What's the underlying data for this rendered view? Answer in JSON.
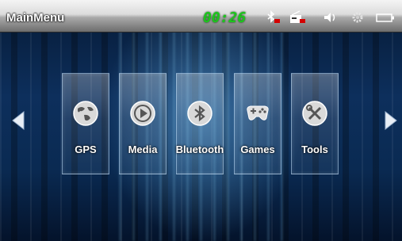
{
  "header": {
    "title": "MainMenu",
    "clock": "00:26",
    "status_icons": [
      "bluetooth-disabled-icon",
      "radio-disabled-icon",
      "volume-icon",
      "settings-icon",
      "battery-icon"
    ]
  },
  "navigation": {
    "prev": "left-arrow-icon",
    "next": "right-arrow-icon"
  },
  "menu": {
    "items": [
      {
        "label": "GPS",
        "icon": "globe-icon"
      },
      {
        "label": "Media",
        "icon": "play-icon"
      },
      {
        "label": "Bluetooth",
        "icon": "bluetooth-icon"
      },
      {
        "label": "Games",
        "icon": "gamepad-icon"
      },
      {
        "label": "Tools",
        "icon": "tools-icon"
      }
    ]
  },
  "colors": {
    "clock": "#1cc71c",
    "background": "#0d2f5c",
    "status_disabled": "#d40000"
  }
}
